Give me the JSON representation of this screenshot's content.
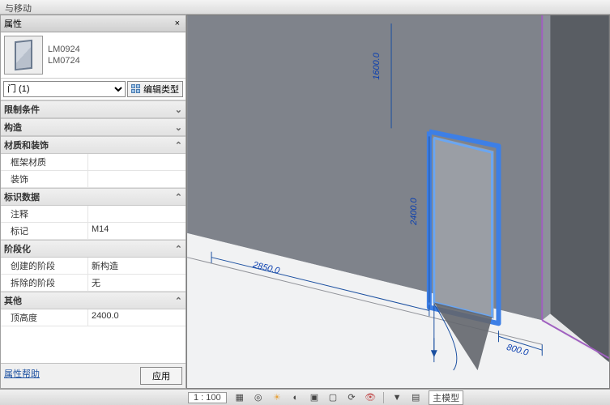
{
  "titlebar": {
    "text": "与移动"
  },
  "panel": {
    "title": "属性",
    "type_line1": "LM0924",
    "type_line2": "LM0724",
    "family_selector": "门 (1)",
    "edit_type_label": "编辑类型",
    "help_link": "属性帮助",
    "apply_label": "应用"
  },
  "categories": {
    "constraints": "限制条件",
    "construction": "构造",
    "materials": "材质和装饰",
    "identity": "标识数据",
    "phasing": "阶段化",
    "other": "其他"
  },
  "props": {
    "frame_material_k": "框架材质",
    "frame_material_v": "",
    "finish_k": "装饰",
    "finish_v": "",
    "comments_k": "注释",
    "comments_v": "",
    "mark_k": "标记",
    "mark_v": "M14",
    "phase_created_k": "创建的阶段",
    "phase_created_v": "新构造",
    "phase_demolished_k": "拆除的阶段",
    "phase_demolished_v": "无",
    "head_height_k": "顶高度",
    "head_height_v": "2400.0"
  },
  "dims": {
    "left": "2850.0",
    "right": "800.0",
    "height": "2400.0",
    "head": "1600.0"
  },
  "status": {
    "scale": "1 : 100",
    "model_mode": "主模型"
  }
}
